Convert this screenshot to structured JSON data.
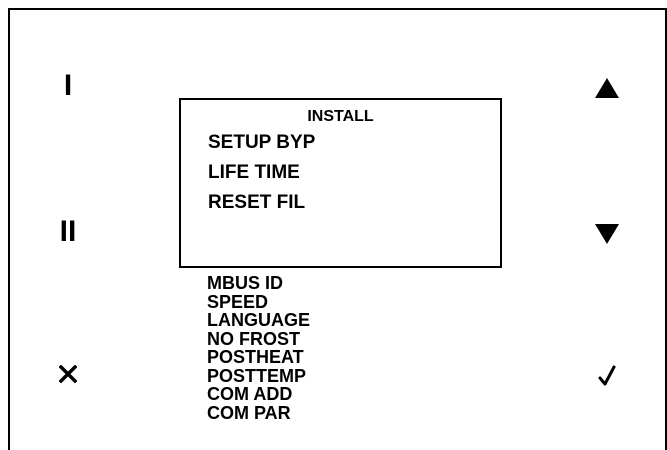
{
  "panel": {
    "left_buttons": {
      "level1_label": "I",
      "level2_label": "II",
      "cancel_icon": "close-icon"
    },
    "right_buttons": {
      "up_icon": "triangle-up-icon",
      "down_icon": "triangle-down-icon",
      "confirm_icon": "checkmark-icon"
    },
    "screen": {
      "title": "INSTALL",
      "items": [
        "SETUP BYP",
        "LIFE TIME",
        "RESET FIL"
      ]
    },
    "more_items": [
      "MBUS ID",
      "SPEED",
      "LANGUAGE",
      "NO FROST",
      "POSTHEAT",
      "POSTTEMP",
      "COM ADD",
      "COM PAR"
    ]
  }
}
